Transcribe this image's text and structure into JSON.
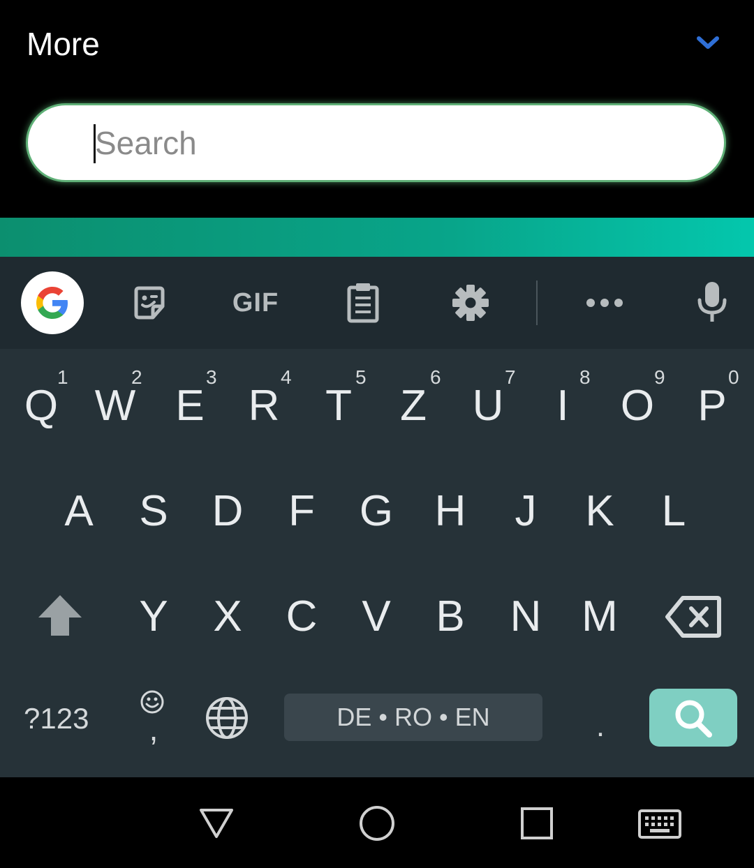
{
  "header": {
    "title": "More",
    "collapse_icon": "chevron-down-icon",
    "accent_color": "#2f6fd6"
  },
  "search": {
    "placeholder": "Search",
    "value": ""
  },
  "keyboard": {
    "toolbar": {
      "items": [
        "google-g-icon",
        "sticker-icon",
        "GIF",
        "clipboard-icon",
        "gear-icon",
        "more-icon",
        "microphone-icon"
      ],
      "gif_label": "GIF"
    },
    "row1": [
      {
        "key": "Q",
        "hint": "1"
      },
      {
        "key": "W",
        "hint": "2"
      },
      {
        "key": "E",
        "hint": "3"
      },
      {
        "key": "R",
        "hint": "4"
      },
      {
        "key": "T",
        "hint": "5"
      },
      {
        "key": "Z",
        "hint": "6"
      },
      {
        "key": "U",
        "hint": "7"
      },
      {
        "key": "I",
        "hint": "8"
      },
      {
        "key": "O",
        "hint": "9"
      },
      {
        "key": "P",
        "hint": "0"
      }
    ],
    "row2": [
      "A",
      "S",
      "D",
      "F",
      "G",
      "H",
      "J",
      "K",
      "L"
    ],
    "row3": [
      "Y",
      "X",
      "C",
      "V",
      "B",
      "N",
      "M"
    ],
    "bottom": {
      "symbols_label": "?123",
      "emoji_comma_label": ",",
      "space_label": "DE • RO • EN",
      "period_label": "."
    },
    "enter_icon": "search-icon",
    "enter_color": "#7fcfc2"
  },
  "navbar": {
    "icons": [
      "back-icon",
      "home-icon",
      "recents-icon",
      "keyboard-switch-icon"
    ]
  }
}
